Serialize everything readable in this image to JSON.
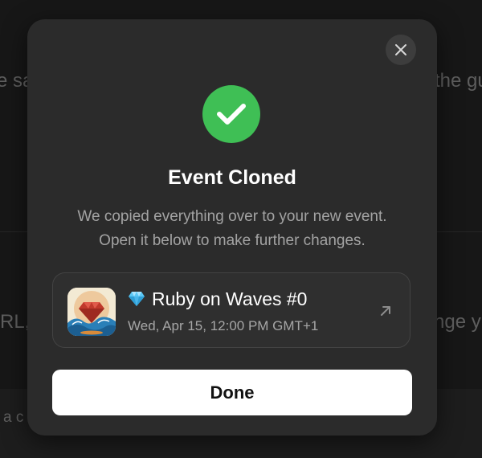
{
  "background": {
    "fragments": [
      "e sa",
      "the gu",
      "RL, f",
      "nge y",
      "a c"
    ]
  },
  "modal": {
    "close_icon": "close-icon",
    "status_icon": "checkmark-icon",
    "title": "Event Cloned",
    "description_line1": "We copied everything over to your new event.",
    "description_line2": "Open it below to make further changes.",
    "event": {
      "emoji": "💎",
      "name": "Ruby on Waves #0",
      "date": "Wed, Apr 15, 12:00 PM GMT+1",
      "link_icon": "arrow-up-right-icon"
    },
    "done_label": "Done"
  },
  "colors": {
    "success": "#3fbf55",
    "modal_bg": "#2b2b2b",
    "button_bg": "#ffffff"
  }
}
